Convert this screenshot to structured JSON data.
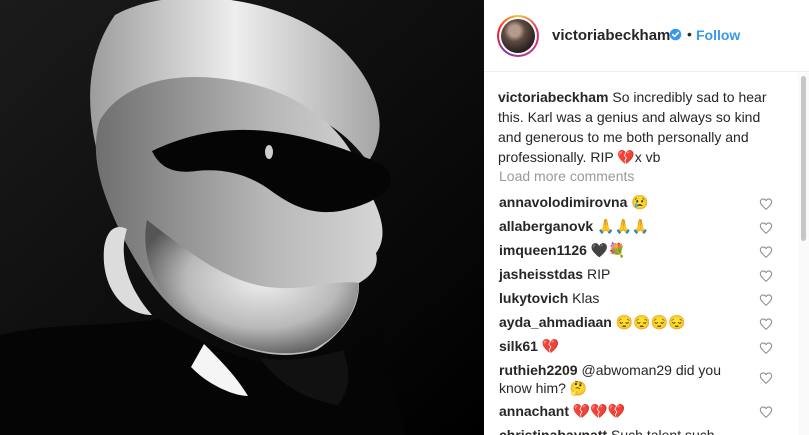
{
  "post": {
    "author": "victoriabeckham",
    "verified": true,
    "follow_label": "Follow",
    "separator": "•",
    "caption_user": "victoriabeckham",
    "caption_text": "So incredibly sad to hear this. Karl was a genius and always so kind and generous to me both personally and professionally. RIP 💔x vb",
    "load_more_label": "Load more comments"
  },
  "comments": [
    {
      "user": "annavolodimirovna",
      "text": "😢"
    },
    {
      "user": "allaberganovk",
      "text": "🙏🙏🙏"
    },
    {
      "user": "imqueen1126",
      "text": "🖤💐"
    },
    {
      "user": "jasheisstdas",
      "text": "RIP"
    },
    {
      "user": "lukytovich",
      "text": "Klas"
    },
    {
      "user": "ayda_ahmadiaan",
      "text": "😔😔😔😔"
    },
    {
      "user": "silk61",
      "text": "💔"
    },
    {
      "user": "ruthieh2209",
      "text": "@abwoman29 did you know him? 🤔"
    },
    {
      "user": "annachant",
      "text": "💔💔💔"
    },
    {
      "user": "christinabaynatt",
      "text": "Such talent such"
    }
  ],
  "icons": {
    "verified": "verified-badge-icon",
    "like": "heart-outline-icon"
  },
  "colors": {
    "link": "#3897f0",
    "text": "#262626",
    "muted": "#999999",
    "divider": "#efefef"
  }
}
